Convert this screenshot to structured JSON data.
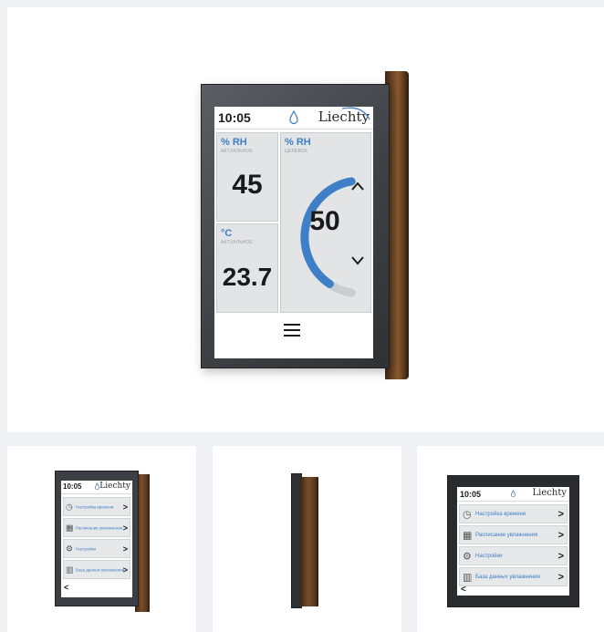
{
  "main": {
    "time": "10:05",
    "brand": "Liechty",
    "humidity_tile": {
      "unit": "% RH",
      "sub": "АКТУАЛЬНОЕ",
      "value": "45"
    },
    "temperature_tile": {
      "unit": "°C",
      "sub": "АКТУАЛЬНОЕ",
      "value": "23.7"
    },
    "setpoint_tile": {
      "unit": "% RH",
      "sub": "ЦЕЛЕВОЕ",
      "value": "50",
      "level": 0.5
    },
    "icons": {
      "drop": "water-drop-icon",
      "up": "chevron-up-icon",
      "down": "chevron-down-icon",
      "menu": "hamburger-menu-icon"
    }
  },
  "thumbs": [
    {
      "time": "10:05",
      "brand": "Liechty",
      "menu": [
        {
          "icon": "clock-icon",
          "label": "Настройка времени",
          "arrow": ">"
        },
        {
          "icon": "calendar-icon",
          "label": "Расписание увлажнения",
          "arrow": ">"
        },
        {
          "icon": "gear-icon",
          "label": "Настройки",
          "arrow": ">"
        },
        {
          "icon": "chart-icon",
          "label": "База данных увлажнения",
          "arrow": ">"
        }
      ],
      "back": "<"
    },
    {
      "time": "10:05",
      "brand": "Liechty",
      "menu": [
        {
          "icon": "clock-icon",
          "label": "Настройка времени",
          "arrow": ">"
        },
        {
          "icon": "calendar-icon",
          "label": "Расписание увлажнения",
          "arrow": ">"
        },
        {
          "icon": "gear-icon",
          "label": "Настройки",
          "arrow": ">"
        },
        {
          "icon": "chart-icon",
          "label": "База данных увлажнения",
          "arrow": ">"
        }
      ],
      "back": "<"
    }
  ],
  "colors": {
    "accent": "#3e7fc7",
    "tile": "#e2e4e6",
    "frame": "#3e4145",
    "wood": "#6b4325"
  }
}
